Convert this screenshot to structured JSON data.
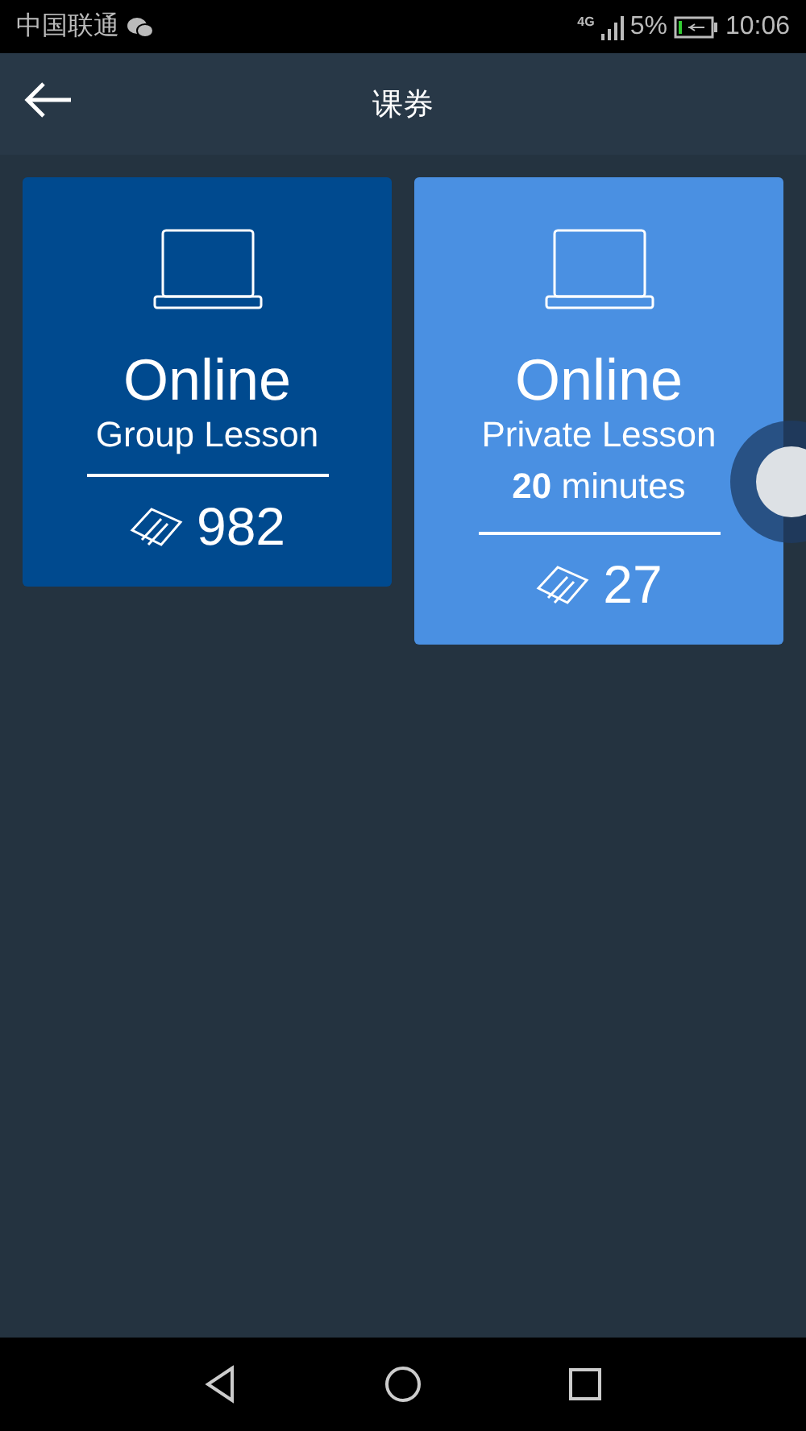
{
  "status_bar": {
    "carrier": "中国联通",
    "network": "4G",
    "battery": "5%",
    "time": "10:06"
  },
  "app_bar": {
    "title": "课券"
  },
  "cards": [
    {
      "title": "Online",
      "subtitle": "Group Lesson",
      "count": "982",
      "color": "#004a8f"
    },
    {
      "title": "Online",
      "subtitle": "Private Lesson",
      "duration": "**20** minutes",
      "count": "27",
      "color": "#4a90e2"
    }
  ]
}
